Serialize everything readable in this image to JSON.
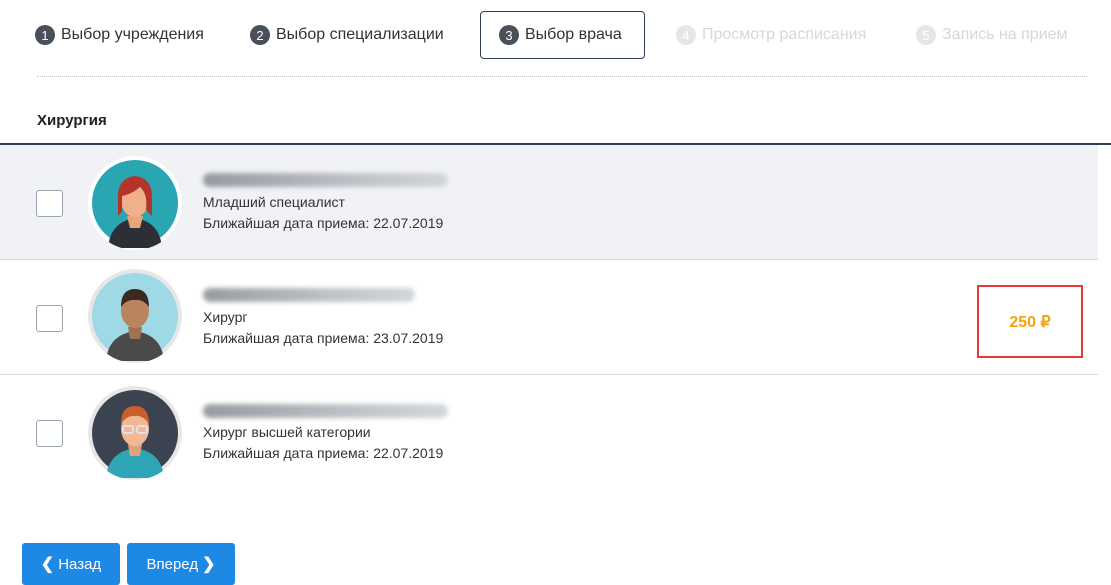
{
  "steps": [
    {
      "num": "1",
      "label": "Выбор учреждения"
    },
    {
      "num": "2",
      "label": "Выбор специализации"
    },
    {
      "num": "3",
      "label": "Выбор врача"
    },
    {
      "num": "4",
      "label": "Просмотр расписания"
    },
    {
      "num": "5",
      "label": "Запись на прием"
    }
  ],
  "section": {
    "title": "Хирургия"
  },
  "doctors": [
    {
      "specialty": "Младший специалист",
      "date": "Ближайшая дата приема: 22.07.2019",
      "price": ""
    },
    {
      "specialty": "Хирург",
      "date": "Ближайшая дата приема: 23.07.2019",
      "price": "250 ₽"
    },
    {
      "specialty": "Хирург высшей категории",
      "date": "Ближайшая дата приема: 22.07.2019",
      "price": ""
    }
  ],
  "buttons": {
    "back": "Назад",
    "next": "Вперед",
    "back_icon": "chevron-left-icon",
    "next_icon": "chevron-right-icon"
  },
  "colors": {
    "accent": "#1e88e5",
    "price": "#f4a30b",
    "highlight": "#e53935",
    "header_line": "#2f3d55"
  }
}
